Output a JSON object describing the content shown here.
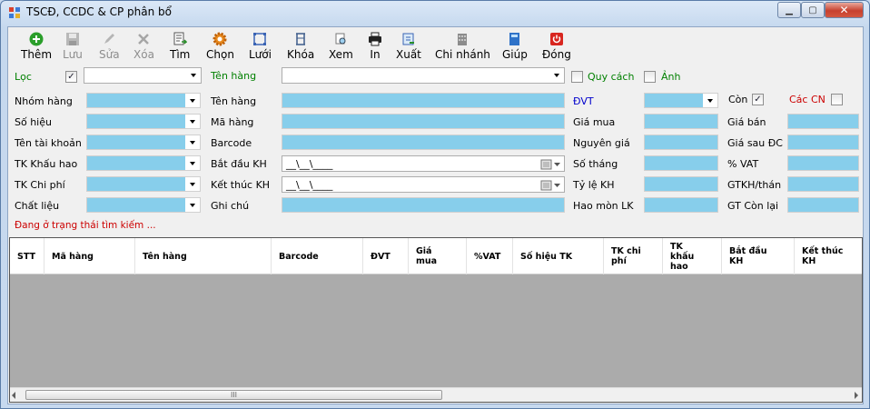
{
  "window": {
    "title": "TSCĐ, CCDC & CP phân bổ",
    "min": "▁",
    "max": "▢",
    "close": "✕"
  },
  "toolbar": [
    {
      "label": "Thêm",
      "icon": "add-icon",
      "enabled": true
    },
    {
      "label": "Lưu",
      "icon": "save-icon",
      "enabled": false
    },
    {
      "label": "Sửa",
      "icon": "edit-icon",
      "enabled": false
    },
    {
      "label": "Xóa",
      "icon": "delete-icon",
      "enabled": false
    },
    {
      "label": "Tìm",
      "icon": "find-icon",
      "enabled": true
    },
    {
      "label": "Chọn",
      "icon": "gear-icon",
      "enabled": true
    },
    {
      "label": "Lưới",
      "icon": "grid-icon",
      "enabled": true
    },
    {
      "label": "Khóa",
      "icon": "lock-icon",
      "enabled": true
    },
    {
      "label": "Xem",
      "icon": "preview-icon",
      "enabled": true
    },
    {
      "label": "In",
      "icon": "printer-icon",
      "enabled": true
    },
    {
      "label": "Xuất",
      "icon": "export-icon",
      "enabled": true
    },
    {
      "label": "Chi nhánh",
      "icon": "branch-icon",
      "enabled": true
    },
    {
      "label": "Giúp",
      "icon": "help-icon",
      "enabled": true
    },
    {
      "label": "Đóng",
      "icon": "power-icon",
      "enabled": true
    }
  ],
  "filter": {
    "loc_label": "Lọc",
    "loc_checked": true,
    "ten_hang_label": "Tên hàng",
    "quy_cach_label": "Quy cách",
    "anh_label": "Ảnh"
  },
  "labels": {
    "nhom_hang": "Nhóm hàng",
    "so_hieu": "Số hiệu",
    "ten_tai_khoan": "Tên tài khoản",
    "tk_khau_hao": "TK Khấu hao",
    "tk_chi_phi": "TK Chi phí",
    "chat_lieu": "Chất liệu",
    "ten_hang": "Tên hàng",
    "ma_hang": "Mã hàng",
    "barcode": "Barcode",
    "bat_dau_kh": "Bắt đầu KH",
    "ket_thuc_kh": "Kết thúc KH",
    "ghi_chu": "Ghi chú",
    "dvt": "ĐVT",
    "gia_mua": "Giá mua",
    "nguyen_gia": "Nguyên giá",
    "so_thang": "Số tháng",
    "ty_le_kh": "Tỷ lệ KH",
    "hao_mon_lk": "Hao mòn LK",
    "con": "Còn",
    "cac_cn": "Các CN",
    "gia_ban": "Giá bán",
    "gia_sau_dc": "Giá sau ĐC",
    "vat": "% VAT",
    "gtkh_thang": "GTKH/thán",
    "gt_con_lai": "GT Còn lại"
  },
  "values": {
    "con_checked": true,
    "cac_cn_checked": false,
    "bat_dau_kh": "__\\__\\____",
    "ket_thuc_kh": "__\\__\\____"
  },
  "status": "Đang ở trạng thái tìm kiếm ...",
  "colors": {
    "field": "#87ceeb",
    "accent_green": "#008000",
    "accent_blue": "#0000cc",
    "accent_red": "#cc0000",
    "grid_bg": "#ababab"
  },
  "grid": {
    "columns": [
      "STT",
      "Mã hàng",
      "Tên hàng",
      "Barcode",
      "ĐVT",
      "Giá\nmua",
      "%VAT",
      "Số hiệu TK",
      "TK chi\nphí",
      "TK\nkhấu\nhao",
      "Bắt đầu\nKH",
      "Kết thúc\nKH"
    ],
    "scroll_thumb": "III"
  }
}
